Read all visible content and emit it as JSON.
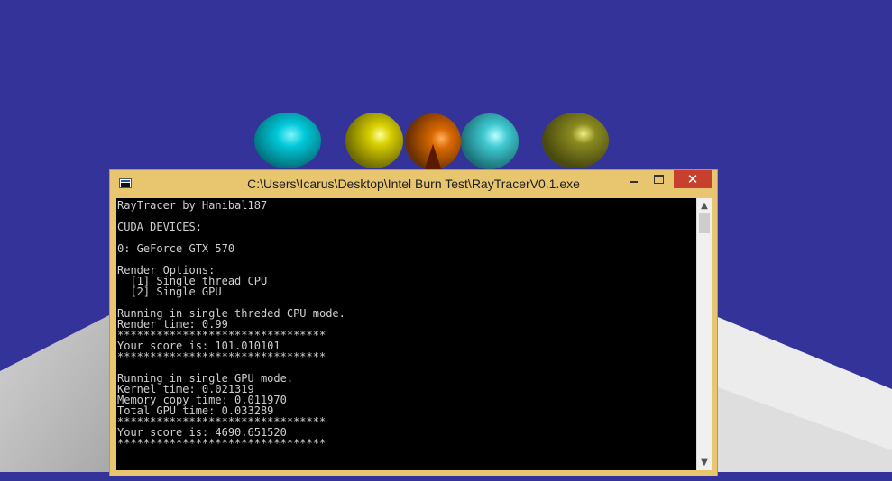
{
  "window": {
    "title": "C:\\Users\\Icarus\\Desktop\\Intel Burn Test\\RayTracerV0.1.exe",
    "close_glyph": "✕"
  },
  "console": {
    "lines": [
      "RayTracer by Hanibal187",
      "",
      "CUDA DEVICES:",
      "",
      "0: GeForce GTX 570",
      "",
      "Render Options:",
      "  [1] Single thread CPU",
      "  [2] Single GPU",
      "",
      "Running in single threded CPU mode.",
      "Render time: 0.99",
      "********************************",
      "Your score is: 101.010101",
      "********************************",
      "",
      "Running in single GPU mode.",
      "Kernel time: 0.021319",
      "Memory copy time: 0.011970",
      "Total GPU time: 0.033289",
      "********************************",
      "Your score is: 4690.651520",
      "********************************"
    ]
  },
  "scrollbar": {
    "up_glyph": "▲",
    "down_glyph": "▼"
  },
  "colors": {
    "sky": "#333399",
    "floor": "#e6e6e6",
    "sphere_cyan": "#00c8d8",
    "sphere_yellow": "#d8d000",
    "sphere_orange": "#d86800",
    "sphere_teal": "#40c8d0",
    "sphere_olive": "#8a8a20",
    "window_frame": "#e8c670",
    "close_button": "#c7402e",
    "console_bg": "#000000",
    "console_text": "#cfcfcf"
  }
}
